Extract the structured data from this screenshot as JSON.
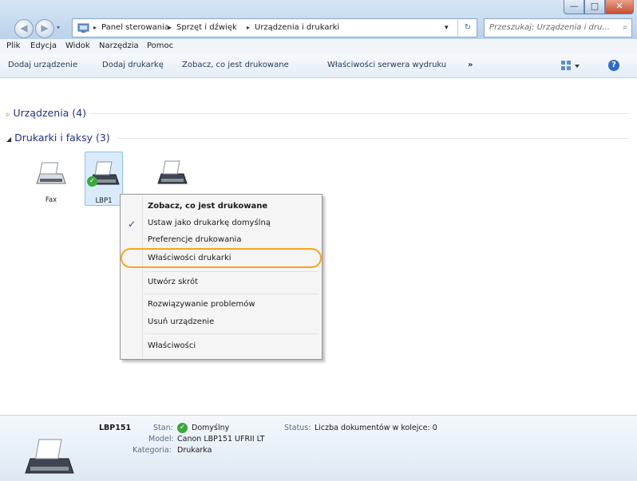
{
  "window": {
    "controls": {
      "minimize": "—",
      "maximize": "□",
      "close": "✕"
    }
  },
  "address_bar": {
    "crumbs": [
      "Panel sterowania",
      "Sprzęt i dźwięk",
      "Urządzenia i drukarki"
    ],
    "separator": "▸",
    "dropdown": "▾",
    "refresh": "↻"
  },
  "search": {
    "placeholder": "Przeszukaj: Urządzenia i dru..."
  },
  "menu": [
    "Plik",
    "Edycja",
    "Widok",
    "Narzędzia",
    "Pomoc"
  ],
  "toolbar": {
    "items": [
      "Dodaj urządzenie",
      "Dodaj drukarkę",
      "Zobacz, co jest drukowane",
      "Właściwości serwera wydruku"
    ],
    "more": "»",
    "view_icon": "view-options-icon",
    "help": "?"
  },
  "groups": {
    "devices": {
      "arrow": "▹",
      "label": "Urządzenia (4)"
    },
    "printers": {
      "arrow": "◢",
      "label": "Drukarki i faksy (3)"
    }
  },
  "devices": [
    {
      "label": "Fax",
      "selected": false
    },
    {
      "label": "LBP1",
      "selected": true,
      "default": true
    },
    {
      "label": "",
      "selected": false
    }
  ],
  "context_menu": {
    "items": [
      {
        "label": "Zobacz, co jest drukowane",
        "bold": true
      },
      {
        "label": "Ustaw jako drukarkę domyślną",
        "checked": true,
        "check": "✓"
      },
      {
        "label": "Preferencje drukowania"
      },
      {
        "label": "Właściwości drukarki",
        "highlighted": true
      },
      {
        "label": "Utwórz skrót"
      },
      {
        "label": "Rozwiązywanie problemów"
      },
      {
        "label": "Usuń urządzenie"
      },
      {
        "label": "Właściwości"
      }
    ]
  },
  "details": {
    "name": "LBP151",
    "state_label": "Stan:",
    "state_value": "Domyślny",
    "status_label": "Status:",
    "status_value": "Liczba dokumentów w kolejce: 0",
    "model_label": "Model:",
    "model_value": "Canon LBP151 UFRII LT",
    "category_label": "Kategoria:",
    "category_value": "Drukarka"
  },
  "colors": {
    "accent_link": "#1e3287",
    "highlight_ring": "#f5a623",
    "selection": "#d9ebfb"
  }
}
